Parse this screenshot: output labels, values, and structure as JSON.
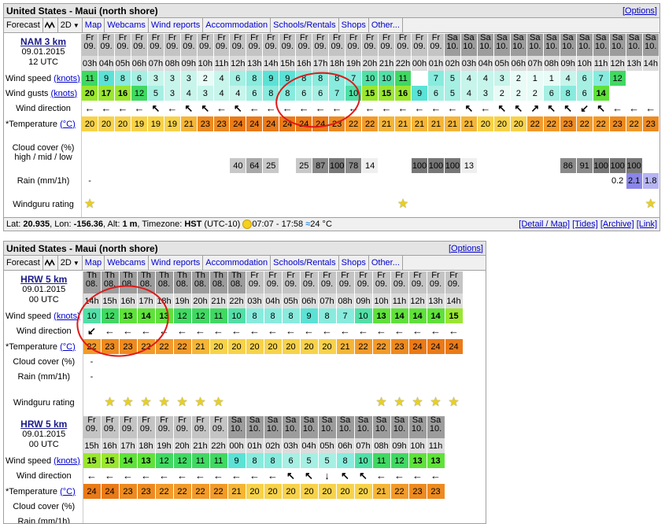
{
  "panel1": {
    "title": "United States - Maui (north shore)",
    "options": "[Options]",
    "tabs": [
      "Forecast",
      "2D",
      "Map",
      "Webcams",
      "Wind reports",
      "Accommodation",
      "Schools/Rentals",
      "Shops",
      "Other..."
    ],
    "model": {
      "name": "NAM 3 km",
      "date": "09.01.2015",
      "run": "12 UTC"
    },
    "days": [
      "Fr 09.",
      "Fr 09.",
      "Fr 09.",
      "Fr 09.",
      "Fr 09.",
      "Fr 09.",
      "Fr 09.",
      "Fr 09.",
      "Fr 09.",
      "Fr 09.",
      "Fr 09.",
      "Fr 09.",
      "Fr 09.",
      "Fr 09.",
      "Fr 09.",
      "Fr 09.",
      "Fr 09.",
      "Fr 09.",
      "Fr 09.",
      "Fr 09.",
      "Sa 10.",
      "Sa 10.",
      "Sa 10.",
      "Sa 10.",
      "Sa 10.",
      "Sa 10.",
      "Sa 10.",
      "Sa 10.",
      "Sa 10.",
      "Sa 10.",
      "Sa 10.",
      "Sa 10.",
      "Sa 10."
    ],
    "hours": [
      "03h",
      "04h",
      "05h",
      "06h",
      "07h",
      "08h",
      "09h",
      "10h",
      "11h",
      "12h",
      "13h",
      "14h",
      "15h",
      "16h",
      "17h",
      "18h",
      "19h",
      "20h",
      "21h",
      "22h",
      "00h",
      "01h",
      "02h",
      "03h",
      "04h",
      "05h",
      "06h",
      "07h",
      "08h",
      "09h",
      "10h",
      "11h",
      "12h",
      "13h",
      "14h"
    ],
    "labels": {
      "wind_speed": "Wind speed",
      "wind_gusts": "Wind gusts",
      "knots": "(knots)",
      "wind_direction": "Wind direction",
      "temperature": "*Temperature",
      "celsius": "(°C)",
      "cloud": "Cloud cover (%)",
      "cloud2": "high / mid / low",
      "rain": "Rain (mm/1h)",
      "rating": "Windguru rating"
    },
    "wind_speed": [
      "11",
      "9",
      "8",
      "6",
      "3",
      "3",
      "3",
      "2",
      "4",
      "6",
      "8",
      "9",
      "9",
      "8",
      "8",
      "8",
      "7",
      "10",
      "10",
      "11",
      "",
      "7",
      "5",
      "4",
      "4",
      "3",
      "2",
      "1",
      "1",
      "4",
      "6",
      "7",
      "12"
    ],
    "wind_gusts": [
      "20",
      "17",
      "16",
      "12",
      "5",
      "3",
      "4",
      "3",
      "4",
      "4",
      "6",
      "8",
      "8",
      "6",
      "6",
      "7",
      "10",
      "15",
      "15",
      "16",
      "9",
      "6",
      "5",
      "4",
      "3",
      "2",
      "2",
      "2",
      "6",
      "8",
      "6",
      "14"
    ],
    "directions": [
      "←",
      "←",
      "←",
      "←",
      "↖",
      "←",
      "↖",
      "↖",
      "←",
      "↖",
      "←",
      "←",
      "←",
      "←",
      "←",
      "←",
      "←",
      "←",
      "←",
      "←",
      "←",
      "←",
      "←",
      "↖",
      "←",
      "↖",
      "↖",
      "↗",
      "↖",
      "↖",
      "↙",
      "↖",
      "←",
      "←",
      "←"
    ],
    "temperature": [
      "20",
      "20",
      "20",
      "19",
      "19",
      "19",
      "21",
      "23",
      "23",
      "24",
      "24",
      "24",
      "24",
      "24",
      "24",
      "23",
      "22",
      "22",
      "21",
      "21",
      "21",
      "21",
      "21",
      "20",
      "20",
      "20",
      "22",
      "22",
      "23",
      "22",
      "23"
    ],
    "cloud": [
      "",
      "",
      "",
      "",
      "",
      "",
      "",
      "",
      "",
      "40",
      "64",
      "25",
      "",
      "25",
      "87",
      "100",
      "78",
      "14",
      "",
      "",
      "100",
      "100",
      "100",
      "13",
      "",
      "",
      "",
      "",
      "86",
      "91",
      "100",
      "100",
      "100"
    ],
    "rain": [
      "-",
      "",
      "",
      "",
      "",
      "",
      "",
      "",
      "",
      "",
      "",
      "",
      "",
      "",
      "",
      "",
      "",
      "",
      "",
      "",
      "",
      "",
      "",
      "",
      "",
      "",
      "",
      "",
      "",
      "",
      "0.2",
      "2.1",
      "1.8"
    ],
    "footer": {
      "lat_label": "Lat:",
      "lat": "20.935",
      "lon_label": ", Lon:",
      "lon": "-156.36",
      "alt_label": ", Alt:",
      "alt": "1 m",
      "tz_label": ", Timezone:",
      "tz": "HST",
      "tz_offset": "(UTC-10)",
      "sun": "07:07 - 17:58",
      "water": "24 °C",
      "links": [
        "[Detail / Map]",
        "[Tides]",
        "[Archive]",
        "[Link]"
      ]
    }
  },
  "panel2": {
    "title": "United States - Maui (north shore)",
    "options": "[Options]",
    "tabs": [
      "Forecast",
      "2D",
      "Map",
      "Webcams",
      "Wind reports",
      "Accommodation",
      "Schools/Rentals",
      "Shops",
      "Other..."
    ],
    "modelA": {
      "name": "HRW 5 km",
      "date": "09.01.2015",
      "run": "00 UTC"
    },
    "daysA": [
      "Th 08.",
      "Th 08.",
      "Th 08.",
      "Th 08.",
      "Th 08.",
      "Th 08.",
      "Th 08.",
      "Th 08.",
      "Th 08.",
      "Fr 09.",
      "Fr 09.",
      "Fr 09.",
      "Fr 09.",
      "Fr 09.",
      "Fr 09.",
      "Fr 09.",
      "Fr 09.",
      "Fr 09.",
      "Fr 09.",
      "Fr 09.",
      "Fr 09.",
      "Fr 09.",
      "Fr 09."
    ],
    "hoursA": [
      "14h",
      "15h",
      "16h",
      "17h",
      "18h",
      "19h",
      "20h",
      "21h",
      "22h",
      "00h",
      "03h",
      "04h",
      "05h",
      "06h",
      "07h",
      "08h",
      "09h",
      "10h",
      "11h",
      "12h",
      "13h",
      "14h"
    ],
    "windA": [
      "10",
      "12",
      "13",
      "14",
      "13",
      "12",
      "12",
      "11",
      "10",
      "8",
      "8",
      "8",
      "9",
      "8",
      "7",
      "10",
      "13",
      "14",
      "14",
      "14",
      "15"
    ],
    "dirA": [
      "↙",
      "←",
      "←",
      "←",
      "←",
      "←",
      "←",
      "←",
      "←",
      "←",
      "←",
      "←",
      "←",
      "←",
      "←",
      "←",
      "←",
      "←",
      "←",
      "←",
      "←",
      "←"
    ],
    "tempA": [
      "22",
      "23",
      "23",
      "22",
      "22",
      "22",
      "21",
      "20",
      "20",
      "20",
      "20",
      "20",
      "20",
      "20",
      "21",
      "22",
      "22",
      "23",
      "24",
      "24",
      "24"
    ],
    "ratingA": "★ ★ ★ ★ ★ ★ ★",
    "ratingA2": "★ ★ ★ ★ ★",
    "modelB": {
      "name": "HRW 5 km",
      "date": "09.01.2015",
      "run": "00 UTC"
    },
    "daysB": [
      "Fr 09.",
      "Fr 09.",
      "Fr 09.",
      "Fr 09.",
      "Fr 09.",
      "Fr 09.",
      "Fr 09.",
      "Fr 09.",
      "Sa 10.",
      "Sa 10.",
      "Sa 10.",
      "Sa 10.",
      "Sa 10.",
      "Sa 10.",
      "Sa 10.",
      "Sa 10.",
      "Sa 10.",
      "Sa 10.",
      "Sa 10.",
      "Sa 10."
    ],
    "hoursB": [
      "15h",
      "16h",
      "17h",
      "18h",
      "19h",
      "20h",
      "21h",
      "22h",
      "00h",
      "01h",
      "02h",
      "03h",
      "04h",
      "05h",
      "06h",
      "07h",
      "08h",
      "09h",
      "10h",
      "11h"
    ],
    "windB": [
      "15",
      "15",
      "14",
      "13",
      "12",
      "12",
      "11",
      "11",
      "9",
      "8",
      "8",
      "6",
      "5",
      "5",
      "8",
      "10",
      "11",
      "12",
      "13",
      "13"
    ],
    "dirB": [
      "←",
      "←",
      "←",
      "←",
      "←",
      "←",
      "←",
      "←",
      "←",
      "←",
      "←",
      "↖",
      "↖",
      "↓",
      "↖",
      "↖",
      "←",
      "←",
      "←",
      "←"
    ],
    "tempB": [
      "24",
      "24",
      "23",
      "23",
      "22",
      "22",
      "22",
      "22",
      "21",
      "20",
      "20",
      "20",
      "20",
      "20",
      "20",
      "20",
      "21",
      "22",
      "23",
      "23"
    ]
  }
}
